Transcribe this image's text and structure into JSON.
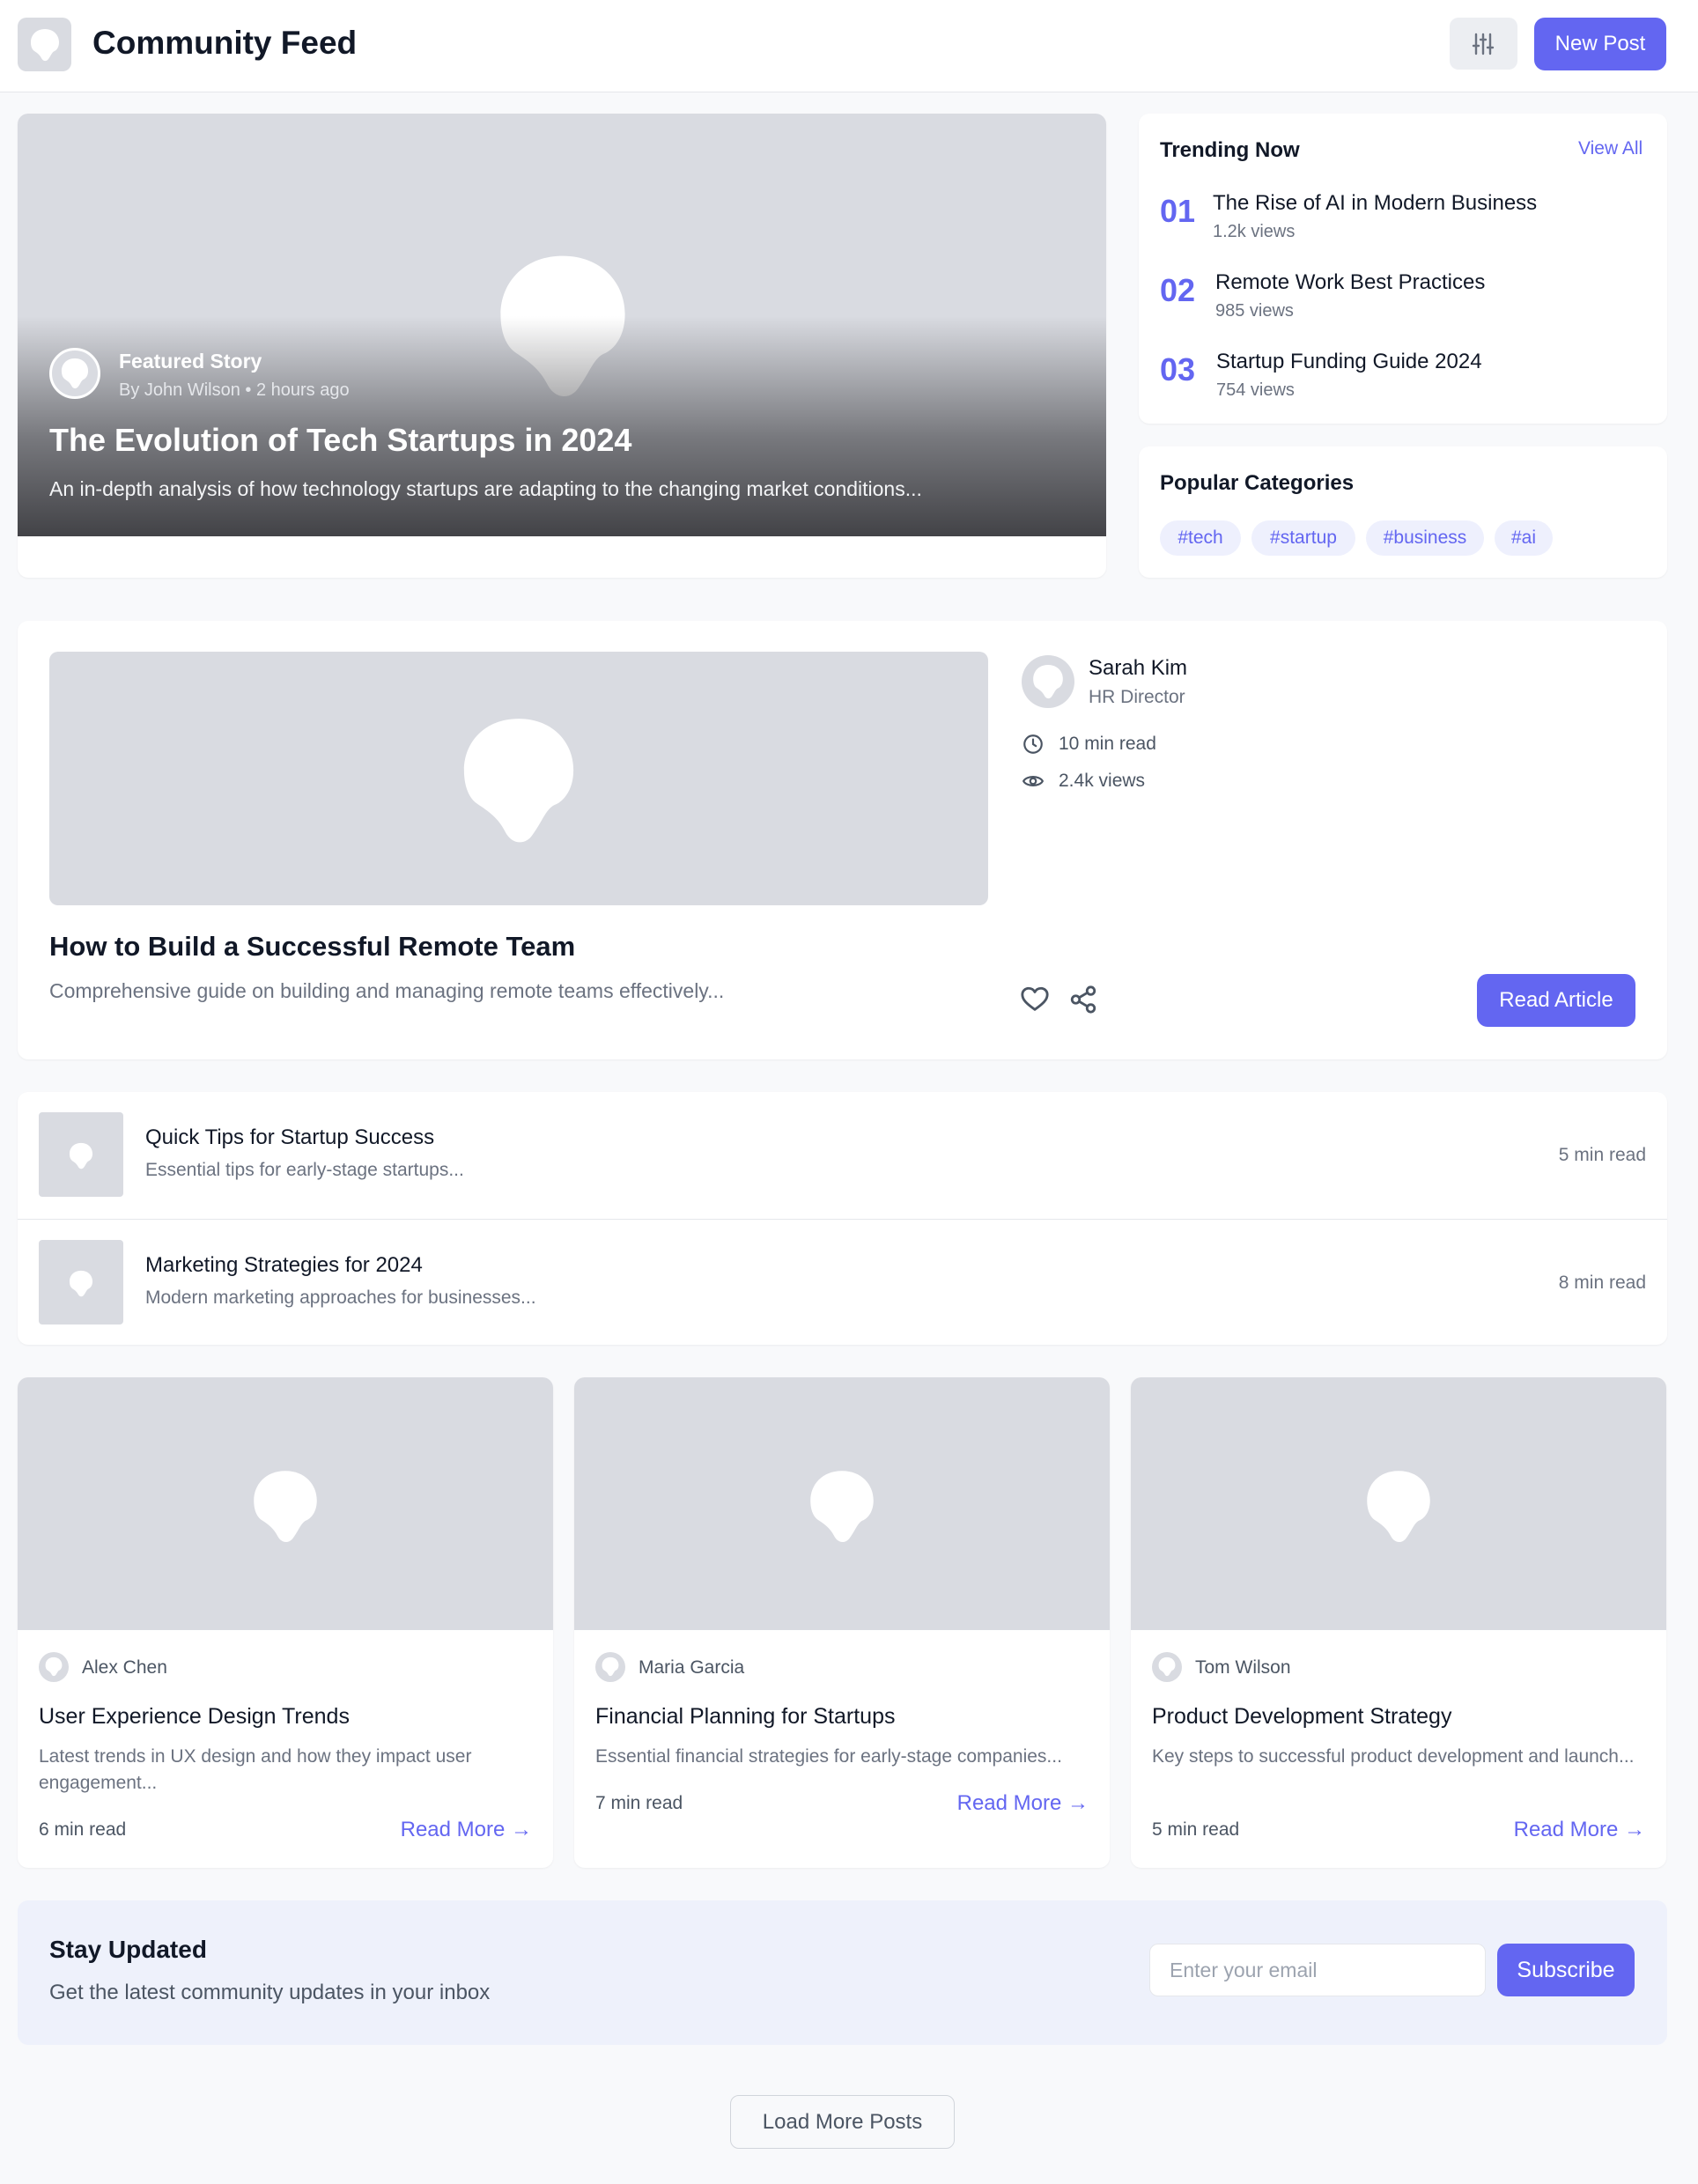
{
  "header": {
    "title": "Community Feed",
    "new_post_label": "New Post"
  },
  "featured": {
    "label": "Featured Story",
    "meta": "By John Wilson • 2 hours ago",
    "title": "The Evolution of Tech Startups in 2024",
    "description": "An in-depth analysis of how technology startups are adapting to the changing market conditions..."
  },
  "trending": {
    "title": "Trending Now",
    "view_all_label": "View All",
    "items": [
      {
        "rank": "01",
        "title": "The Rise of AI in Modern Business",
        "views": "1.2k views"
      },
      {
        "rank": "02",
        "title": "Remote Work Best Practices",
        "views": "985 views"
      },
      {
        "rank": "03",
        "title": "Startup Funding Guide 2024",
        "views": "754 views"
      }
    ]
  },
  "categories": {
    "title": "Popular Categories",
    "tags": [
      "#tech",
      "#startup",
      "#business",
      "#ai"
    ]
  },
  "remote_post": {
    "title": "How to Build a Successful Remote Team",
    "description": "Comprehensive guide on building and managing remote teams effectively...",
    "author_name": "Sarah Kim",
    "author_role": "HR Director",
    "read_time": "10 min read",
    "views": "2.4k views",
    "read_label": "Read Article"
  },
  "list_posts": [
    {
      "title": "Quick Tips for Startup Success",
      "description": "Essential tips for early-stage startups...",
      "read_time": "5 min read"
    },
    {
      "title": "Marketing Strategies for 2024",
      "description": "Modern marketing approaches for businesses...",
      "read_time": "8 min read"
    }
  ],
  "grid_posts": [
    {
      "author": "Alex Chen",
      "title": "User Experience Design Trends",
      "description": "Latest trends in UX design and how they impact user engagement...",
      "read_time": "6 min read",
      "more_label": "Read More →"
    },
    {
      "author": "Maria Garcia",
      "title": "Financial Planning for Startups",
      "description": "Essential financial strategies for early-stage companies...",
      "read_time": "7 min read",
      "more_label": "Read More →"
    },
    {
      "author": "Tom Wilson",
      "title": "Product Development Strategy",
      "description": "Key steps to successful product development and launch...",
      "read_time": "5 min read",
      "more_label": "Read More →"
    }
  ],
  "newsletter": {
    "title": "Stay Updated",
    "subtitle": "Get the latest community updates in your inbox",
    "email_placeholder": "Enter your email",
    "subscribe_label": "Subscribe"
  },
  "load_more_label": "Load More Posts",
  "colors": {
    "accent": "#6366f1",
    "placeholder_bg": "#d9dbe1",
    "newsletter_bg": "#eef1fb"
  },
  "icons": {
    "logo": "image-placeholder-icon",
    "filter": "sliders-icon",
    "clock": "clock-icon",
    "eye": "eye-icon",
    "like": "heart-icon",
    "share": "share-icon"
  }
}
